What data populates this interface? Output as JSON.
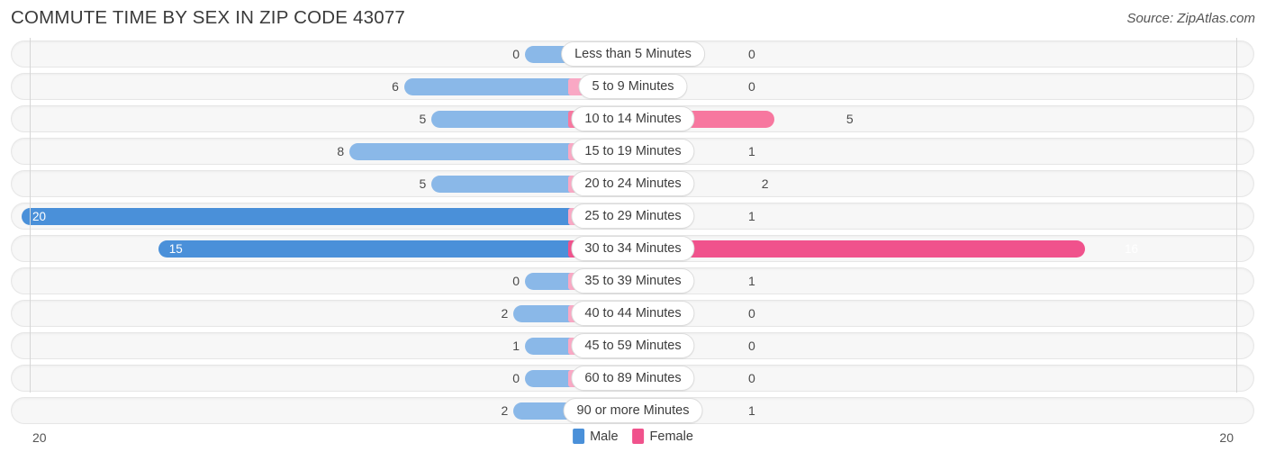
{
  "header": {
    "title": "COMMUTE TIME BY SEX IN ZIP CODE 43077",
    "source": "Source: ZipAtlas.com"
  },
  "legend": {
    "male_label": "Male",
    "female_label": "Female",
    "male_color": "#4a90d9",
    "female_color": "#f0528c"
  },
  "axis": {
    "left_tick": "20",
    "right_tick": "20",
    "max": 20
  },
  "chart_data": {
    "type": "bar",
    "title": "COMMUTE TIME BY SEX IN ZIP CODE 43077",
    "subtitle": "Source: ZipAtlas.com",
    "orientation": "horizontal-diverging",
    "xlabel": "",
    "ylabel": "",
    "xlim": [
      20,
      20
    ],
    "grid": false,
    "legend_position": "bottom-center",
    "categories": [
      "Less than 5 Minutes",
      "5 to 9 Minutes",
      "10 to 14 Minutes",
      "15 to 19 Minutes",
      "20 to 24 Minutes",
      "25 to 29 Minutes",
      "30 to 34 Minutes",
      "35 to 39 Minutes",
      "40 to 44 Minutes",
      "45 to 59 Minutes",
      "60 to 89 Minutes",
      "90 or more Minutes"
    ],
    "series": [
      {
        "name": "Male",
        "values": [
          0,
          6,
          5,
          8,
          5,
          20,
          15,
          0,
          2,
          1,
          0,
          2
        ]
      },
      {
        "name": "Female",
        "values": [
          0,
          0,
          5,
          1,
          2,
          1,
          16,
          1,
          0,
          0,
          0,
          1
        ]
      }
    ]
  },
  "rows": [
    {
      "label": "Less than 5 Minutes",
      "male": "0",
      "female": "0",
      "male_pct": 0,
      "female_pct": 0,
      "male_peak": false,
      "female_peak": false,
      "female_mid": false
    },
    {
      "label": "5 to 9 Minutes",
      "male": "6",
      "female": "0",
      "male_pct": 0.3,
      "female_pct": 0,
      "male_peak": false,
      "female_peak": false,
      "female_mid": false
    },
    {
      "label": "10 to 14 Minutes",
      "male": "5",
      "female": "5",
      "male_pct": 0.25,
      "female_pct": 0.25,
      "male_peak": false,
      "female_peak": false,
      "female_mid": true
    },
    {
      "label": "15 to 19 Minutes",
      "male": "8",
      "female": "1",
      "male_pct": 0.4,
      "female_pct": 0.05,
      "male_peak": false,
      "female_peak": false,
      "female_mid": false
    },
    {
      "label": "20 to 24 Minutes",
      "male": "5",
      "female": "2",
      "male_pct": 0.25,
      "female_pct": 0.1,
      "male_peak": false,
      "female_peak": false,
      "female_mid": false
    },
    {
      "label": "25 to 29 Minutes",
      "male": "20",
      "female": "1",
      "male_pct": 1.0,
      "female_pct": 0.05,
      "male_peak": true,
      "female_peak": false,
      "female_mid": false
    },
    {
      "label": "30 to 34 Minutes",
      "male": "15",
      "female": "16",
      "male_pct": 0.75,
      "female_pct": 0.8,
      "male_peak": true,
      "female_peak": true,
      "female_mid": false
    },
    {
      "label": "35 to 39 Minutes",
      "male": "0",
      "female": "1",
      "male_pct": 0,
      "female_pct": 0.05,
      "male_peak": false,
      "female_peak": false,
      "female_mid": false
    },
    {
      "label": "40 to 44 Minutes",
      "male": "2",
      "female": "0",
      "male_pct": 0.1,
      "female_pct": 0,
      "male_peak": false,
      "female_peak": false,
      "female_mid": false
    },
    {
      "label": "45 to 59 Minutes",
      "male": "1",
      "female": "0",
      "male_pct": 0.05,
      "female_pct": 0,
      "male_peak": false,
      "female_peak": false,
      "female_mid": false
    },
    {
      "label": "60 to 89 Minutes",
      "male": "0",
      "female": "0",
      "male_pct": 0,
      "female_pct": 0,
      "male_peak": false,
      "female_peak": false,
      "female_mid": false
    },
    {
      "label": "90 or more Minutes",
      "male": "2",
      "female": "1",
      "male_pct": 0.1,
      "female_pct": 0.05,
      "male_peak": false,
      "female_peak": false,
      "female_mid": false
    }
  ]
}
